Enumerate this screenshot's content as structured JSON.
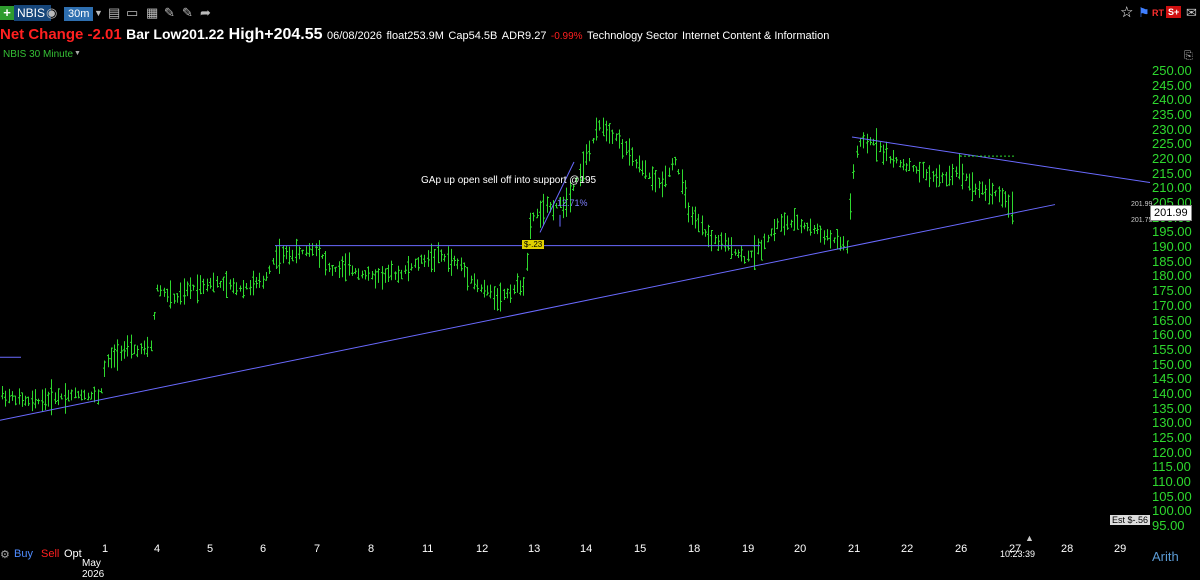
{
  "toolbar": {
    "symbol": "NBIS",
    "timeframe": "30m",
    "icons": [
      "camera-icon",
      "chart-type-icon",
      "bar-chart-icon",
      "calc-icon",
      "pencil-icon",
      "draw-icon",
      "share-icon"
    ],
    "right_icons": [
      "star-icon",
      "flag-icon",
      "rt-badge",
      "s-plus-badge",
      "message-icon"
    ],
    "rt_label": "RT",
    "s_label": "S+"
  },
  "header": {
    "net_change": "Net Change -2.01",
    "bar_low": "Bar Low201.22",
    "high": "High+204.55",
    "date": "06/08/2026",
    "float": "float253.9M",
    "cap": "Cap54.5B",
    "adr": "ADR9.27",
    "pct": "-0.99%",
    "sector": "Technology Sector",
    "industry": "Internet Content & Information"
  },
  "chart_label": "NBIS 30 Minute",
  "y_ticks": [
    "250.00",
    "245.00",
    "240.00",
    "235.00",
    "230.00",
    "225.00",
    "220.00",
    "215.00",
    "210.00",
    "205.00",
    "200.00",
    "195.00",
    "190.00",
    "185.00",
    "180.00",
    "175.00",
    "170.00",
    "165.00",
    "160.00",
    "155.00",
    "150.00",
    "145.00",
    "140.00",
    "135.00",
    "130.00",
    "125.00",
    "120.00",
    "115.00",
    "110.00",
    "105.00",
    "100.00",
    "95.00"
  ],
  "x_ticks": [
    "1",
    "4",
    "5",
    "6",
    "7",
    "8",
    "11",
    "12",
    "13",
    "14",
    "15",
    "18",
    "19",
    "20",
    "21",
    "22",
    "26",
    "27",
    "28",
    "29"
  ],
  "month_label": "May 2026",
  "last_price": "201.99",
  "hi_label": "201.99",
  "lo_label": "201.75",
  "annotation": "GAp up open sell off into support @195",
  "pct_label": "12.71%",
  "marker_label": "$-.23",
  "est_label": "Est $-.56",
  "clock": "10:23:39",
  "scale": "Arith",
  "bottom": {
    "buy": "Buy",
    "sell": "Sell",
    "opt": "Opt"
  },
  "colors": {
    "bars": "#2ed82e",
    "lines": "#6a6aff",
    "axis": "#2ed82e",
    "neg": "#ff2020"
  },
  "chart_data": {
    "type": "ohlc",
    "title": "NBIS 30 Minute",
    "ylim": [
      95,
      250
    ],
    "scale": "arithmetic",
    "x": [
      "1",
      "4",
      "5",
      "6",
      "7",
      "8",
      "11",
      "12",
      "13",
      "14",
      "15",
      "18",
      "19",
      "20",
      "21",
      "22",
      "26",
      "27"
    ],
    "close": [
      138,
      176,
      178,
      187,
      188,
      182,
      186,
      176,
      200,
      228,
      215,
      197,
      186,
      198,
      220,
      215,
      212,
      201.99
    ],
    "last": 201.99,
    "annotations": [
      "GAp up open sell off into support @195",
      "12.71%",
      "$-.23"
    ]
  }
}
